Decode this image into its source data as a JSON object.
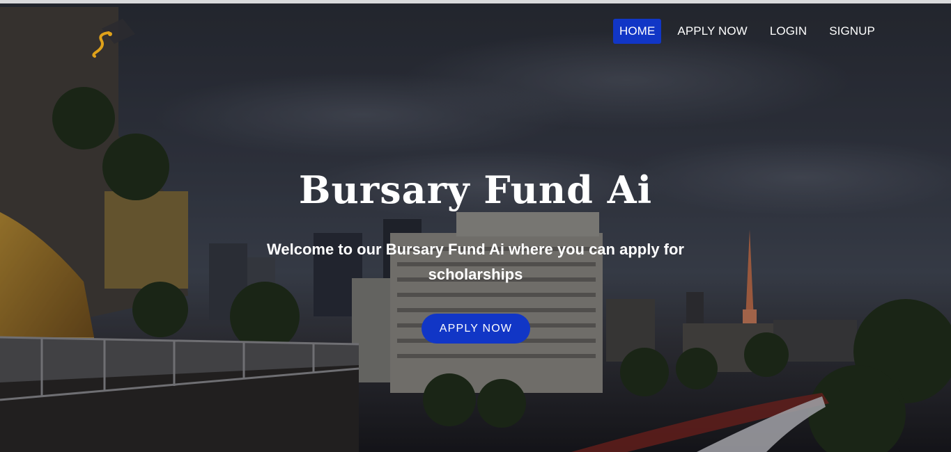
{
  "brand": {
    "logo_icon": "scholar-cap-logo-icon",
    "accent": "#1136c6"
  },
  "nav": {
    "items": [
      {
        "label": "HOME",
        "active": true
      },
      {
        "label": "APPLY NOW",
        "active": false
      },
      {
        "label": "LOGIN",
        "active": false
      },
      {
        "label": "SIGNUP",
        "active": false
      }
    ]
  },
  "hero": {
    "title": "Bursary Fund Ai",
    "subtitle": "Welcome to our Bursary Fund Ai where you can apply for scholarships",
    "cta_label": "APPLY NOW",
    "background": "night-city-photo"
  }
}
